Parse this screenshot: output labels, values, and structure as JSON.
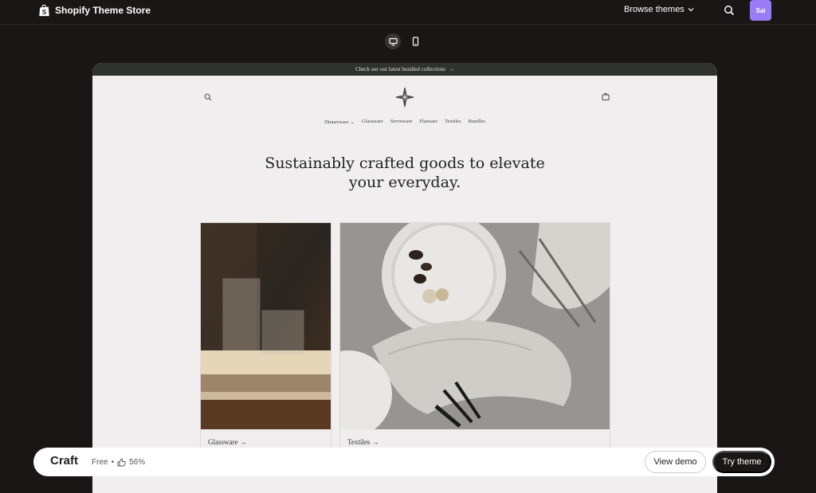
{
  "app": {
    "title": "Shopify Theme Store",
    "browse_label": "Browse themes",
    "avatar_initials": "Sai"
  },
  "preview": {
    "announcement": "Check our our latest bundled collections",
    "nav": [
      "Dinnerware",
      "Glassware",
      "Serveware",
      "Flatware",
      "Textiles",
      "Bundles"
    ],
    "hero_line1": "Sustainably crafted goods to elevate",
    "hero_line2": "your everyday.",
    "cards": [
      {
        "label": "Glassware →"
      },
      {
        "label": "Textiles →"
      }
    ]
  },
  "theme": {
    "name": "Craft",
    "price": "Free",
    "rating": "56%",
    "view_demo": "View demo",
    "try_theme": "Try theme"
  },
  "colors": {
    "accent": "#9b7cf7",
    "announcement_bg": "#2f332d"
  }
}
